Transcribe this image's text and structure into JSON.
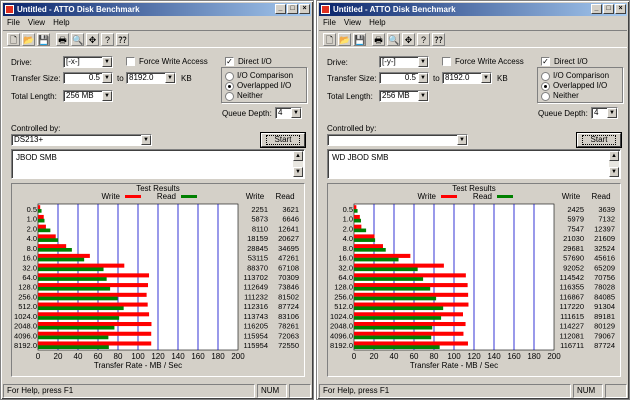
{
  "menu": [
    "File",
    "View",
    "Help"
  ],
  "labels": {
    "drive": "Drive:",
    "transfer_size": "Transfer Size:",
    "to": "to",
    "kb": "KB",
    "total_length": "Total Length:",
    "force_write": "Force Write Access",
    "direct_io": "Direct I/O",
    "io_comparison": "I/O Comparison",
    "overlapped": "Overlapped I/O",
    "neither": "Neither",
    "queue_depth": "Queue Depth:",
    "controlled_by": "Controlled by:",
    "start": "Start",
    "test_results": "Test Results",
    "write": "Write",
    "read": "Read",
    "xlabel": "Transfer Rate - MB / Sec",
    "status": "For Help, press F1",
    "num": "NUM"
  },
  "windows": [
    {
      "title": "Untitled - ATTO Disk Benchmark",
      "drive": "[-x-]",
      "size_from": "0.5",
      "size_to": "8192.0",
      "total_length": "256 MB",
      "queue_depth": "4",
      "controlled_by": "DS213+",
      "description": "JBOD SMB",
      "force_write": false,
      "direct_io": true,
      "io_mode": "overlapped"
    },
    {
      "title": "Untitled - ATTO Disk Benchmark",
      "drive": "[-y-]",
      "size_from": "0.5",
      "size_to": "8192.0",
      "total_length": "256 MB",
      "queue_depth": "4",
      "controlled_by": "",
      "description": "WD JBOD SMB",
      "force_write": false,
      "direct_io": true,
      "io_mode": "overlapped"
    }
  ],
  "colors": {
    "write": "#ff0000",
    "read": "#008000",
    "grid": "#0000cc"
  },
  "chart_data": [
    {
      "type": "bar",
      "categories": [
        "0.5",
        "1.0",
        "2.0",
        "4.0",
        "8.0",
        "16.0",
        "32.0",
        "64.0",
        "128.0",
        "256.0",
        "512.0",
        "1024.0",
        "2048.0",
        "4096.0",
        "8192.0"
      ],
      "series": [
        {
          "name": "Write",
          "values": [
            2251,
            5873,
            8110,
            18159,
            28845,
            53115,
            88370,
            113702,
            112649,
            111232,
            112316,
            113743,
            116205,
            115954,
            115954
          ]
        },
        {
          "name": "Read",
          "values": [
            3621,
            6646,
            12641,
            20627,
            34695,
            47261,
            67108,
            70309,
            73846,
            81502,
            87724,
            83106,
            78261,
            72063,
            72550
          ]
        }
      ],
      "xlabel": "Transfer Rate - MB / Sec",
      "xticks": [
        0,
        20,
        40,
        60,
        80,
        100,
        120,
        140,
        160,
        180,
        200
      ],
      "xlim": [
        0,
        200
      ],
      "value_unit_divisor": 1024
    },
    {
      "type": "bar",
      "categories": [
        "0.5",
        "1.0",
        "2.0",
        "4.0",
        "8.0",
        "16.0",
        "32.0",
        "64.0",
        "128.0",
        "256.0",
        "512.0",
        "1024.0",
        "2048.0",
        "4096.0",
        "8192.0"
      ],
      "series": [
        {
          "name": "Write",
          "values": [
            2425,
            5979,
            7547,
            21030,
            29681,
            57690,
            92052,
            114542,
            116355,
            116867,
            117220,
            111615,
            114227,
            112081,
            116711
          ]
        },
        {
          "name": "Read",
          "values": [
            3639,
            7132,
            12397,
            21609,
            32524,
            45616,
            65209,
            70756,
            78028,
            84085,
            91304,
            89181,
            80129,
            79067,
            87724
          ]
        }
      ],
      "xlabel": "Transfer Rate - MB / Sec",
      "xticks": [
        0,
        20,
        40,
        60,
        80,
        100,
        120,
        140,
        160,
        180,
        200
      ],
      "xlim": [
        0,
        200
      ],
      "value_unit_divisor": 1024
    }
  ]
}
